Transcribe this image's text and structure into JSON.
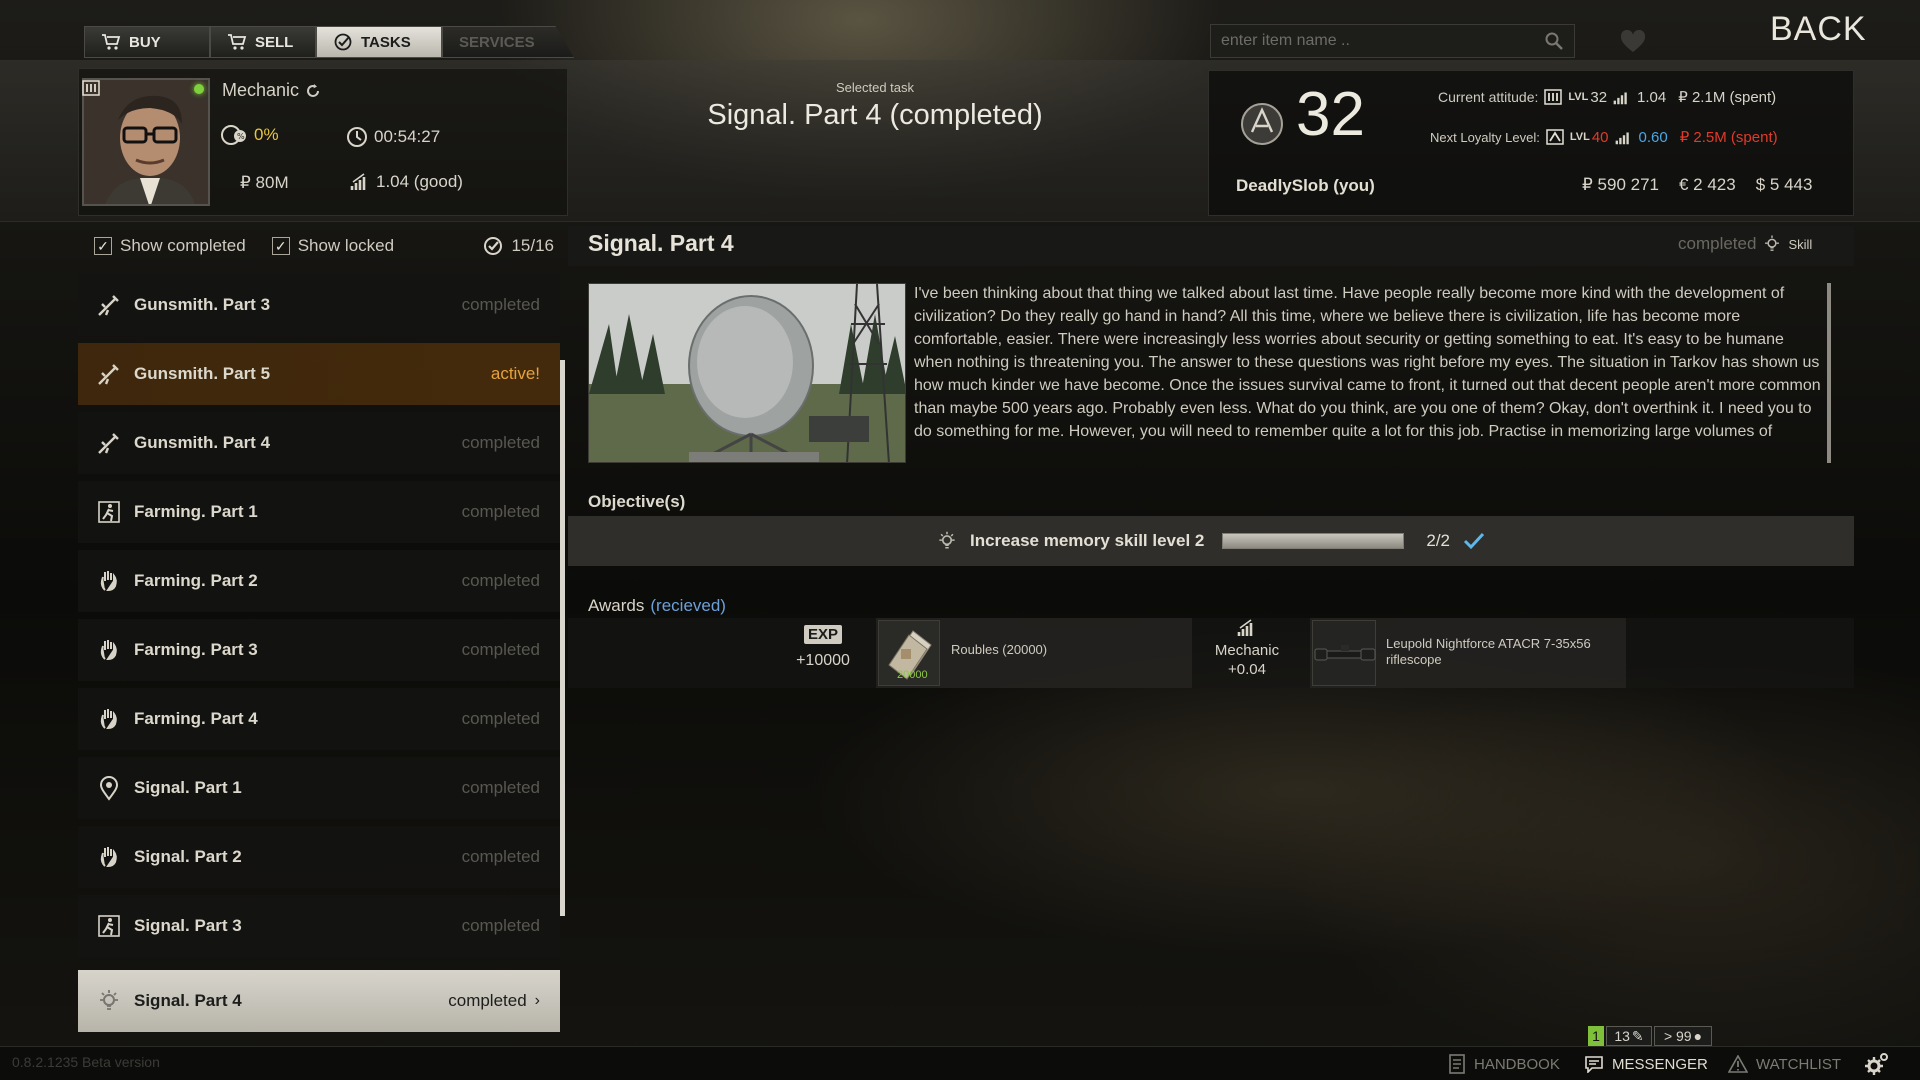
{
  "nav": {
    "tabs": [
      {
        "label": "BUY",
        "icon": "cart-icon"
      },
      {
        "label": "SELL",
        "icon": "cart-icon"
      },
      {
        "label": "TASKS",
        "icon": "check-circle-icon"
      },
      {
        "label": "SERVICES",
        "icon": ""
      }
    ],
    "active_tab": "TASKS",
    "search_placeholder": "enter item name ..",
    "back_label": "BACK"
  },
  "trader": {
    "name": "Mechanic",
    "percent": "0%",
    "timer": "00:54:27",
    "money": "₽ 80M",
    "standing": "1.04 (good)",
    "online": true
  },
  "selected_task": {
    "caption": "Selected task",
    "title": "Signal. Part 4 (completed)"
  },
  "player": {
    "level": "32",
    "name": "DeadlySlob (you)",
    "current_attitude_label": "Current attitude:",
    "current": {
      "lvl_label": "LVL",
      "lvl": "32",
      "standing": "1.04",
      "spent": "₽ 2.1M (spent)"
    },
    "next_loyalty_label": "Next Loyalty Level:",
    "next": {
      "lvl_label": "LVL",
      "lvl": "40",
      "standing": "0.60",
      "spent": "₽ 2.5M (spent)"
    },
    "roubles": "₽ 590 271",
    "euros": "€ 2 423",
    "dollars": "$ 5 443"
  },
  "filters": {
    "show_completed": "Show completed",
    "show_locked": "Show locked",
    "count": "15/16"
  },
  "tasks": [
    {
      "name": "Gunsmith. Part 3",
      "status": "completed",
      "icon": "rifle-icon"
    },
    {
      "name": "Gunsmith. Part 5",
      "status": "active!",
      "icon": "rifle-icon"
    },
    {
      "name": "Gunsmith. Part 4",
      "status": "completed",
      "icon": "rifle-icon"
    },
    {
      "name": "Farming. Part 1",
      "status": "completed",
      "icon": "runner-icon"
    },
    {
      "name": "Farming. Part 2",
      "status": "completed",
      "icon": "hand-icon"
    },
    {
      "name": "Farming. Part 3",
      "status": "completed",
      "icon": "hand-icon"
    },
    {
      "name": "Farming. Part 4",
      "status": "completed",
      "icon": "hand-icon"
    },
    {
      "name": "Signal. Part 1",
      "status": "completed",
      "icon": "map-pin-icon"
    },
    {
      "name": "Signal. Part 2",
      "status": "completed",
      "icon": "hand-icon"
    },
    {
      "name": "Signal. Part 3",
      "status": "completed",
      "icon": "runner-icon"
    },
    {
      "name": "Signal. Part 4",
      "status": "completed",
      "icon": "lightbulb-icon"
    }
  ],
  "detail": {
    "title": "Signal. Part 4",
    "status": "completed",
    "type_label": "Skill",
    "description": "I've been thinking about that thing we talked about last time. Have people really become more kind with the development of civilization? Do they really go hand in hand? All this time, where we believe there is civilization, life has become more comfortable, easier. There were increasingly less worries about security or getting something to eat. It's easy to be humane when nothing is threatening you. The answer to these questions was right before my eyes. The situation in Tarkov has shown us how much kinder we have become. Once the issues survival came to front, it turned out that decent people aren't more common than maybe 500 years ago. Probably even less. What do you think, are you one of them? Okay, don't overthink it. I need you to do something for me. However, you will need to remember quite a lot for this job. Practise in memorizing large volumes of",
    "objectives_label": "Objective(s)",
    "objective": {
      "text": "Increase memory skill level 2",
      "progress": "2/2",
      "progress_fraction": 1.0
    },
    "awards_label": "Awards",
    "awards_received": "(recieved)",
    "awards": {
      "exp_badge": "EXP",
      "exp_value": "+10000",
      "roubles_label": "Roubles (20000)",
      "roubles_amount": "20000",
      "trader_name": "Mechanic",
      "trader_bonus": "+0.04",
      "item_label": "Leupold Nightforce ATACR 7-35x56 riflescope"
    }
  },
  "bottom": {
    "version": "0.8.2.1235 Beta version",
    "counters": [
      "1",
      "13",
      "> 99"
    ],
    "handbook": "HANDBOOK",
    "messenger": "MESSENGER",
    "watchlist": "WATCHLIST"
  },
  "colors": {
    "accent_active": "#e6a23c",
    "lvl_next": "#e23a2a",
    "standing_next": "#4aa7e6",
    "received": "#6f9fd8",
    "check": "#5fb6e8",
    "counter_green": "#7ec03a"
  }
}
